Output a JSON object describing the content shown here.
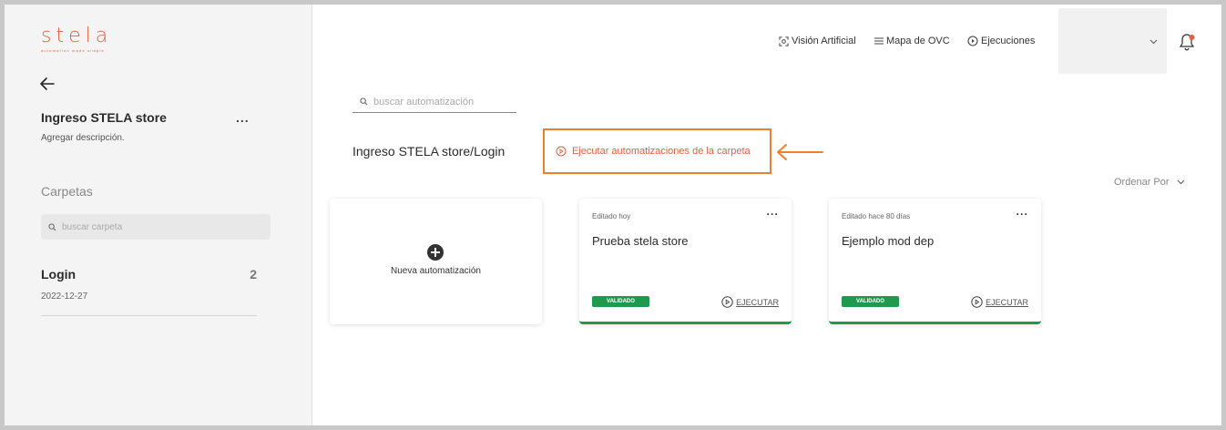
{
  "brand": {
    "name": "stela",
    "tagline": "automation made simple"
  },
  "sidebar": {
    "title": "Ingreso STELA store",
    "description": "Agregar descripción.",
    "more_label": "...",
    "section_label": "Carpetas",
    "search": {
      "placeholder": "buscar carpeta",
      "value": ""
    },
    "folders": [
      {
        "name": "Login",
        "count": "2",
        "date": "2022-12-27"
      }
    ]
  },
  "header": {
    "nav": [
      {
        "label": "Visión Artificial",
        "icon": "vision-icon"
      },
      {
        "label": "Mapa de OVC",
        "icon": "menu-icon"
      },
      {
        "label": "Ejecuciones",
        "icon": "play-circle-icon"
      }
    ]
  },
  "main": {
    "search": {
      "placeholder": "buscar automatización",
      "value": ""
    },
    "breadcrumb": "Ingreso STELA store/Login",
    "run_folder_label": "Ejecutar automatizaciones de la carpeta",
    "sort_label": "Ordenar Por",
    "new_card_label": "Nueva automatización",
    "cards": [
      {
        "edited": "Editado hoy",
        "name": "Prueba stela store",
        "badge": "VALIDADO",
        "run_label": "EJECUTAR"
      },
      {
        "edited": "Editado hace 80 días",
        "name": "Ejemplo mod dep",
        "badge": "VALIDADO",
        "run_label": "EJECUTAR"
      }
    ]
  },
  "colors": {
    "brand": "#e2613f",
    "highlight": "#ee7f2d",
    "validated": "#1e9a4f"
  }
}
